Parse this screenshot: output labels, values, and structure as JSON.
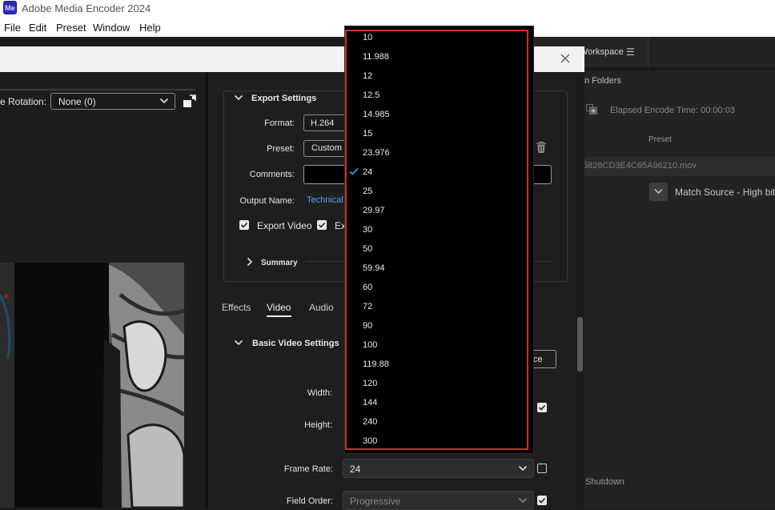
{
  "app": {
    "title": "Adobe Media Encoder 2024",
    "icon_text": "Me"
  },
  "menu": [
    "File",
    "Edit",
    "Preset",
    "Window",
    "Help"
  ],
  "background": {
    "workspace_label": "Workspace",
    "folders_label": "n Folders",
    "elapsed": "Elapsed Encode Time:  00:00:03",
    "preset_header": "Preset",
    "queue_file": "5828CD3E4C65A96210.mov",
    "queue_preset": "Match Source - High bitra",
    "shutdown": "Shutdown"
  },
  "left": {
    "rotation_label": "e Rotation:",
    "rotation_value": "None (0)"
  },
  "export": {
    "title": "Export Settings",
    "format_label": "Format:",
    "format_value": "H.264",
    "preset_label": "Preset:",
    "preset_value": "Custom",
    "comments_label": "Comments:",
    "output_label": "Output Name:",
    "output_value": "Technical",
    "export_video": "Export Video",
    "export_audio": "Ex",
    "summary": "Summary"
  },
  "tabs": [
    "Effects",
    "Video",
    "Audio"
  ],
  "video": {
    "section": "Basic Video Settings",
    "match_source": "ce",
    "width_label": "Width:",
    "height_label": "Height:",
    "frame_rate_label": "Frame Rate:",
    "frame_rate_value": "24",
    "field_order_label": "Field Order:",
    "field_order_value": "Progressive"
  },
  "frame_rate_options": [
    "10",
    "11.988",
    "12",
    "12.5",
    "14.985",
    "15",
    "23.976",
    "24",
    "25",
    "29.97",
    "30",
    "50",
    "59.94",
    "60",
    "72",
    "90",
    "100",
    "119.88",
    "120",
    "144",
    "240",
    "300"
  ],
  "selected_frame_rate": "24",
  "colors": {
    "accent_link": "#5a9ff0",
    "highlight_border": "#d42a2a",
    "checkmark": "#4a90e2"
  }
}
